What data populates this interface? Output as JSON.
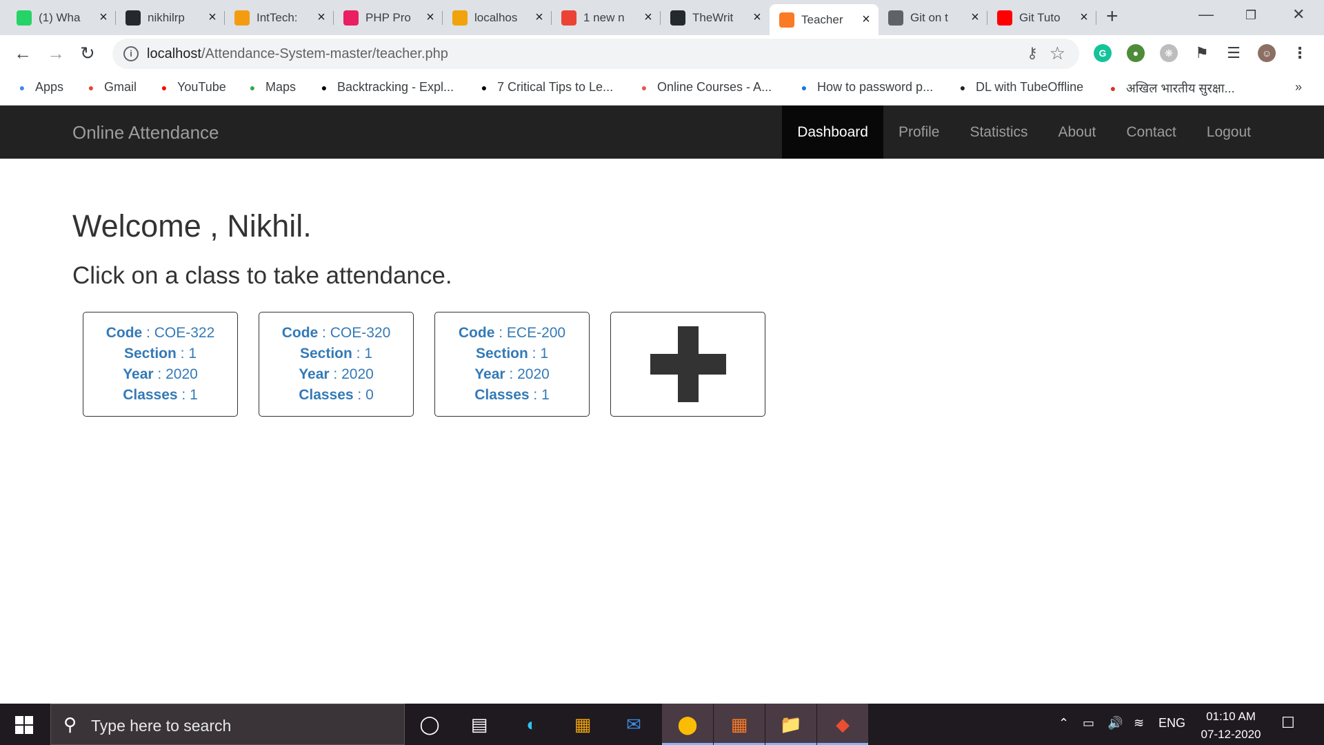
{
  "browser": {
    "tabs": [
      {
        "title": "(1) Wha",
        "favicon": "whatsapp-icon",
        "color": "#25d366"
      },
      {
        "title": "nikhilrp",
        "favicon": "github-icon",
        "color": "#24292e"
      },
      {
        "title": "IntTech:",
        "favicon": "inttech-icon",
        "color": "#f39c12"
      },
      {
        "title": "PHP Pro",
        "favicon": "book-icon",
        "color": "#e91e63"
      },
      {
        "title": "localhos",
        "favicon": "phpmyadmin-icon",
        "color": "#f0a30a"
      },
      {
        "title": "1 new n",
        "favicon": "notification-icon",
        "color": "#ea4335"
      },
      {
        "title": "TheWrit",
        "favicon": "github-icon",
        "color": "#24292e"
      },
      {
        "title": "Teacher",
        "favicon": "xampp-icon",
        "color": "#fb7a24"
      },
      {
        "title": "Git on t",
        "favicon": "document-icon",
        "color": "#5f6368"
      },
      {
        "title": "Git Tuto",
        "favicon": "youtube-icon",
        "color": "#ff0000"
      }
    ],
    "active_tab_index": 7,
    "url_host": "localhost",
    "url_path": "/Attendance-System-master/teacher.php",
    "bookmarks": [
      {
        "label": "Apps",
        "icon": "apps-grid-icon",
        "color": "#4285f4"
      },
      {
        "label": "Gmail",
        "icon": "gmail-icon",
        "color": "#ea4335"
      },
      {
        "label": "YouTube",
        "icon": "youtube-icon",
        "color": "#ff0000"
      },
      {
        "label": "Maps",
        "icon": "maps-pin-icon",
        "color": "#34a853"
      },
      {
        "label": "Backtracking - Expl...",
        "icon": "play-icon",
        "color": "#000000"
      },
      {
        "label": "7 Critical Tips to Le...",
        "icon": "play-icon",
        "color": "#000000"
      },
      {
        "label": "Online Courses - A...",
        "icon": "udemy-icon",
        "color": "#ec5252"
      },
      {
        "label": "How to password p...",
        "icon": "on-icon",
        "color": "#1a73e8"
      },
      {
        "label": "DL with TubeOffline",
        "icon": "globe-icon",
        "color": "#202124"
      },
      {
        "label": "अखिल भारतीय सुरक्षा...",
        "icon": "shield-icon",
        "color": "#d93025"
      }
    ],
    "bookmarks_overflow": "»"
  },
  "app": {
    "brand": "Online Attendance",
    "nav": [
      "Dashboard",
      "Profile",
      "Statistics",
      "About",
      "Contact",
      "Logout"
    ],
    "active_nav": "Dashboard",
    "welcome": "Welcome , Nikhil.",
    "instruction": "Click on a class to take attendance.",
    "labels": {
      "code": "Code",
      "section": "Section",
      "year": "Year",
      "classes": "Classes"
    },
    "classes": [
      {
        "code": "COE-322",
        "section": "1",
        "year": "2020",
        "classes": "1"
      },
      {
        "code": "COE-320",
        "section": "1",
        "year": "2020",
        "classes": "0"
      },
      {
        "code": "ECE-200",
        "section": "1",
        "year": "2020",
        "classes": "1"
      }
    ],
    "link_color": "#337ab7"
  },
  "taskbar": {
    "search_placeholder": "Type here to search",
    "language": "ENG",
    "time": "01:10 AM",
    "date": "07-12-2020"
  }
}
